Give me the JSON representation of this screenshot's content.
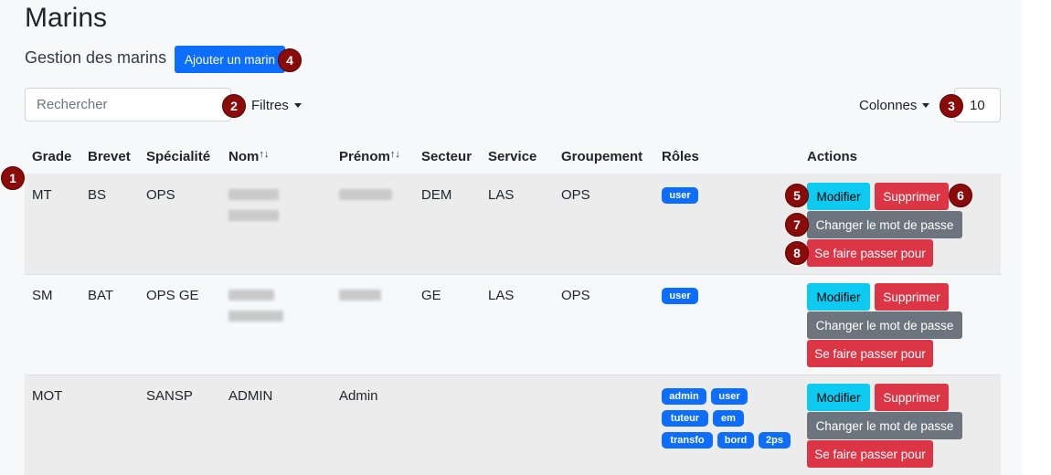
{
  "header": {
    "title": "Marins",
    "subtitle": "Gestion des marins",
    "add_button": "Ajouter un marin"
  },
  "toolbar": {
    "search_placeholder": "Rechercher",
    "filters_label": "Filtres",
    "columns_label": "Colonnes",
    "page_size": "10"
  },
  "markers": [
    "1",
    "2",
    "3",
    "4",
    "5",
    "6",
    "7",
    "8"
  ],
  "table": {
    "headers": {
      "grade": "Grade",
      "brevet": "Brevet",
      "specialite": "Spécialité",
      "nom": "Nom",
      "prenom": "Prénom",
      "secteur": "Secteur",
      "service": "Service",
      "groupement": "Groupement",
      "roles": "Rôles",
      "actions": "Actions"
    },
    "sort_icon": "↑↓",
    "rows": [
      {
        "grade": "MT",
        "brevet": "BS",
        "specialite": "OPS",
        "nom": "",
        "prenom": "",
        "secteur": "DEM",
        "service": "LAS",
        "groupement": "OPS",
        "roles": [
          "user"
        ]
      },
      {
        "grade": "SM",
        "brevet": "BAT",
        "specialite": "OPS GE",
        "nom": "",
        "prenom": "",
        "secteur": "GE",
        "service": "LAS",
        "groupement": "OPS",
        "roles": [
          "user"
        ]
      },
      {
        "grade": "MOT",
        "brevet": "",
        "specialite": "SANSP",
        "nom": "ADMIN",
        "prenom": "Admin",
        "secteur": "",
        "service": "",
        "groupement": "",
        "roles": [
          "admin",
          "user",
          "tuteur",
          "em",
          "transfo",
          "bord",
          "2ps"
        ]
      }
    ],
    "actions": {
      "edit": "Modifier",
      "delete": "Supprimer",
      "change_password": "Changer le mot de passe",
      "impersonate": "Se faire passer pour"
    }
  },
  "colors": {
    "primary": "#0d6efd",
    "info": "#0dcaf0",
    "danger": "#dc3545",
    "secondary": "#6c757d",
    "marker": "#8b0a0a"
  }
}
